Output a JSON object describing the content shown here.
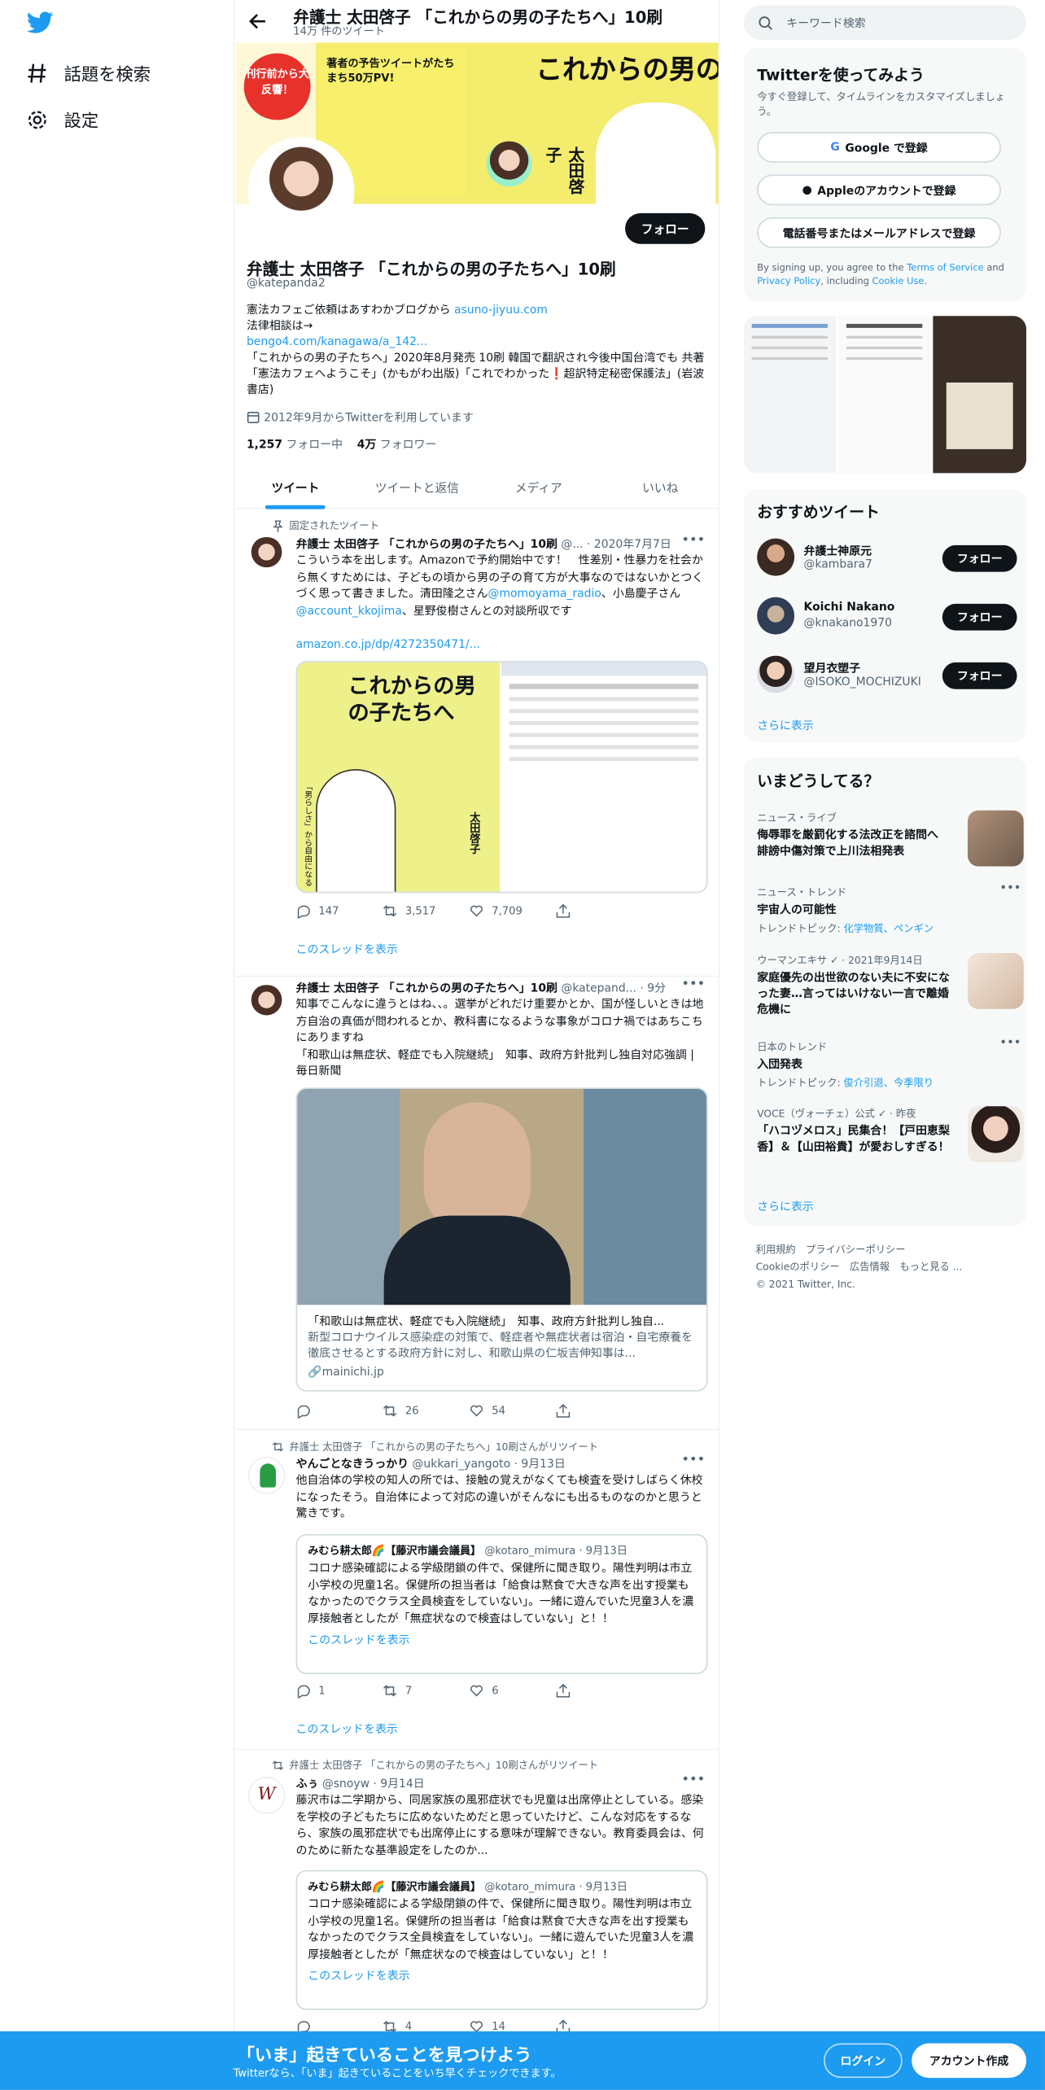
{
  "nav": {
    "explore_label": "話題を検索",
    "settings_label": "設定"
  },
  "profile_header": {
    "title": "弁護士 太田啓子 「これからの男の子たちへ」10刷",
    "tweet_count": "14万 件のツイート"
  },
  "banner": {
    "badge": "刊行前から大反響！",
    "headline": "これからの男の子たちへ",
    "promo": "著者の予告ツイートがたちまち50万PV!",
    "author": "太田啓子"
  },
  "profile": {
    "follow_label": "フォロー",
    "name": "弁護士 太田啓子 「これからの男の子たちへ」10刷",
    "handle": "@katepanda2",
    "bio_line1": "憲法カフェご依頼はあすわかブログから ",
    "bio_link1": "asuno-jiyuu.com",
    "bio_line2": "法律相談は→",
    "bio_link2": "bengo4.com/kanagawa/a_142...",
    "bio_line3": "「これからの男の子たちへ」2020年8月発売 10刷 韓国で翻訳され今後中国台湾でも 共著「憲法カフェへようこそ」(かもがわ出版)「これでわかった❗️超訳特定秘密保護法」(岩波書店)",
    "joined": "2012年9月からTwitterを利用しています",
    "following_count": "1,257",
    "following_label": " フォロー中",
    "followers_count": "4万",
    "followers_label": " フォロワー"
  },
  "tabs": [
    "ツイート",
    "ツイートと返信",
    "メディア",
    "いいね"
  ],
  "tweets": [
    {
      "context": "固定されたツイート",
      "name": "弁護士 太田啓子 「これからの男の子たちへ」10刷",
      "meta": "@... · 2020年7月7日",
      "text_a": "こういう本を出します。Amazonで予約開始中です！　性差別・性暴力を社会から無くすためには、子どもの頃から男の子の育て方が大事なのではないかとつくづく思って書きました。清田隆之さん",
      "mention1": "@momoyama_radio",
      "text_b": "、小島慶子さん",
      "mention2": "@account_kkojima",
      "text_c": "、星野俊樹さんとの対談所収です",
      "link": "amazon.co.jp/dp/4272350471/...",
      "replies": "147",
      "retweets": "3,517",
      "likes": "7,709",
      "thread": "このスレッドを表示",
      "cover_title": "これからの男の子たちへ",
      "cover_sub": "「男らしさ」から自由になる",
      "cover_author": "太田啓子"
    },
    {
      "name": "弁護士 太田啓子 「これからの男の子たちへ」10刷",
      "meta": "@katepand... · 9分",
      "text": "知事でこんなに違うとはね、、。選挙がどれだけ重要かとか、国が怪しいときは地方自治の真価が問われるとか、教科書になるような事象がコロナ禍ではあちこちにありますね\n「和歌山は無症状、軽症でも入院継続」　知事、政府方針批判し独自対応強調 | 毎日新聞",
      "card_title": "「和歌山は無症状、軽症でも入院継続」　知事、政府方針批判し独自...",
      "card_desc": "新型コロナウイルス感染症の対策で、軽症者や無症状者は宿泊・自宅療養を徹底させるとする政府方針に対し、和歌山県の仁坂吉伸知事は...",
      "card_domain": "mainichi.jp",
      "replies": "",
      "retweets": "26",
      "likes": "54"
    },
    {
      "context": "弁護士 太田啓子 「これからの男の子たちへ」10刷さんがリツイート",
      "name": "やんごとなきうっかり",
      "meta": "@ukkari_yangoto · 9月13日",
      "text": "他自治体の学校の知人の所では、接触の覚えがなくても検査を受けしばらく休校になったそう。自治体によって対応の違いがそんなにも出るものなのかと思うと驚きです。",
      "quote_name": "みむら耕太郎🌈【藤沢市議会議員】",
      "quote_meta": "@kotaro_mimura · 9月13日",
      "quote_text": "コロナ感染確認による学級閉鎖の件で、保健所に聞き取り。陽性判明は市立小学校の児童1名。保健所の担当者は「給食は黙食で大きな声を出す授業もなかったのでクラス全員検査をしていない」。一緒に遊んでいた児童3人を濃厚接触者としたが「無症状なので検査はしていない」と！！",
      "quote_thread": "このスレッドを表示",
      "replies": "1",
      "retweets": "7",
      "likes": "6",
      "thread": "このスレッドを表示"
    },
    {
      "context": "弁護士 太田啓子 「これからの男の子たちへ」10刷さんがリツイート",
      "name": "ふぅ",
      "meta": "@snoyw · 9月14日",
      "text": "藤沢市は二学期から、同居家族の風邪症状でも児童は出席停止としている。感染を学校の子どもたちに広めないためだと思っていたけど、こんな対応をするなら、家族の風邪症状でも出席停止にする意味が理解できない。教育委員会は、何のために新たな基準設定をしたのか...",
      "quote_name": "みむら耕太郎🌈【藤沢市議会議員】",
      "quote_meta": "@kotaro_mimura · 9月13日",
      "quote_text": "コロナ感染確認による学級閉鎖の件で、保健所に聞き取り。陽性判明は市立小学校の児童1名。保健所の担当者は「給食は黙食で大きな声を出す授業もなかったのでクラス全員検査をしていない」。一緒に遊んでいた児童3人を濃厚接触者としたが「無症状なので検査はしていない」と！！",
      "quote_thread": "このスレッドを表示",
      "retweets": "4",
      "likes": "14"
    }
  ],
  "search": {
    "placeholder": "キーワード検索"
  },
  "signup_box": {
    "title": "Twitterを使ってみよう",
    "subtitle": "今すぐ登録して、タイムラインをカスタマイズしましょう。",
    "google": "Google で登録",
    "apple": "Appleのアカウントで登録",
    "phone": "電話番号またはメールアドレスで登録",
    "terms_pre": "By signing up, you agree to the ",
    "terms_link": "Terms of Service",
    "terms_mid": " and ",
    "privacy_link": "Privacy Policy",
    "terms_mid2": ", including ",
    "cookie_link": "Cookie Use",
    "terms_end": "."
  },
  "recommended": {
    "title": "おすすめツイート",
    "users": [
      {
        "name": "弁護士神原元",
        "handle": "@kambara7",
        "follow": "フォロー"
      },
      {
        "name": "Koichi Nakano",
        "handle": "@knakano1970",
        "follow": "フォロー"
      },
      {
        "name": "望月衣塑子",
        "handle": "@ISOKO_MOCHIZUKI",
        "follow": "フォロー"
      }
    ],
    "more": "さらに表示"
  },
  "trends": {
    "title": "いまどうしてる？",
    "items": [
      {
        "category": "ニュース・ライブ",
        "title": "侮辱罪を厳罰化する法改正を諮問へ 誹謗中傷対策で上川法相発表",
        "sub": ""
      },
      {
        "category": "ニュース・トレンド",
        "title": "宇宙人の可能性",
        "sub_pre": "トレンドトピック: ",
        "sub_links": "化学物質、ペンギン"
      },
      {
        "category": "ウーマンエキサ ✓ · 2021年9月14日",
        "title": "家庭優先の出世欲のない夫に不安になった妻…言ってはいけない一言で離婚危機に",
        "sub": ""
      },
      {
        "category": "日本のトレンド",
        "title": "入団発表",
        "sub_pre": "トレンドトピック: ",
        "sub_links": "俊介引退、今季限り"
      },
      {
        "category": "VOCE（ヴォーチェ）公式 ✓ · 昨夜",
        "title": "「ハコヅメロス」民集合！【戸田恵梨香】＆【山田裕貴】が愛おしすぎる！",
        "sub": ""
      }
    ],
    "more": "さらに表示"
  },
  "footer": {
    "links": "利用規約　プライバシーポリシー",
    "links2": "Cookieのポリシー　広告情報　もっと見る ...",
    "copyright": "© 2021 Twitter, Inc."
  },
  "bottom_bar": {
    "title": "「いま」起きていることを見つけよう",
    "subtitle": "Twitterなら、「いま」起きていることをいち早くチェックできます。",
    "login": "ログイン",
    "signup": "アカウント作成"
  },
  "colors": {
    "accent": "#1d9bf0",
    "text": "#0f1419",
    "muted": "#536471"
  }
}
